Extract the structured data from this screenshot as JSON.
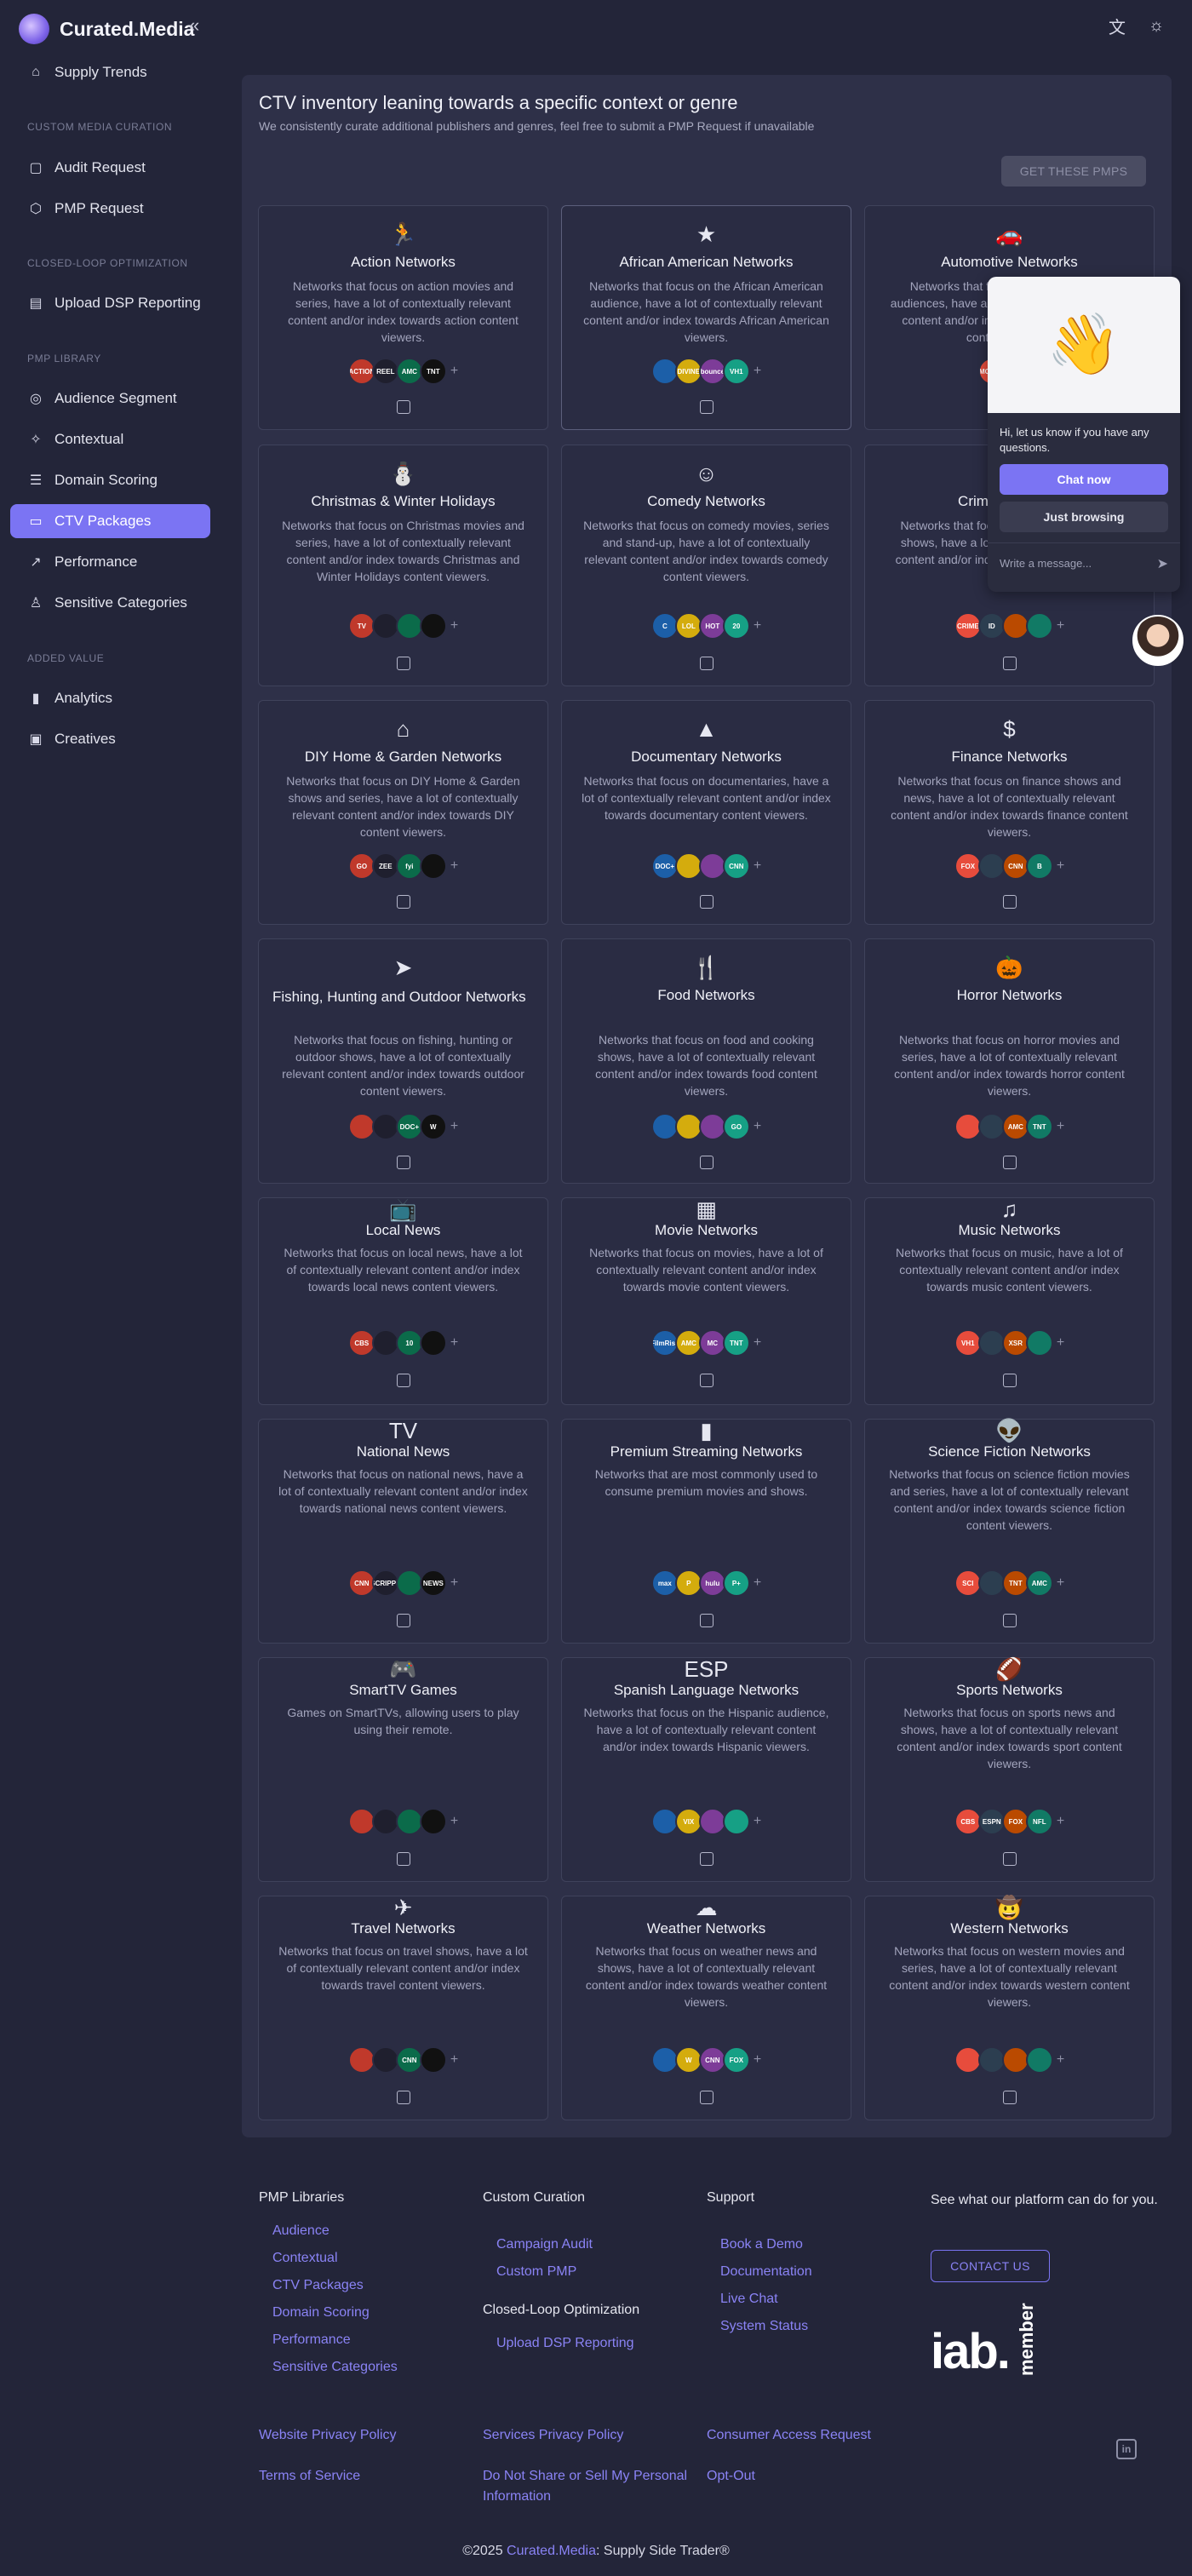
{
  "brand": {
    "name": "Curated.Media"
  },
  "sidebar": {
    "top_items": [
      {
        "label": "Supply Trends",
        "icon": "trend-icon"
      }
    ],
    "sections": [
      {
        "title": "CUSTOM MEDIA CURATION",
        "items": [
          {
            "label": "Audit Request"
          },
          {
            "label": "PMP Request"
          }
        ]
      },
      {
        "title": "CLOSED-LOOP OPTIMIZATION",
        "items": [
          {
            "label": "Upload DSP Reporting"
          }
        ]
      },
      {
        "title": "PMP LIBRARY",
        "items": [
          {
            "label": "Audience Segment"
          },
          {
            "label": "Contextual"
          },
          {
            "label": "Domain Scoring"
          },
          {
            "label": "CTV Packages",
            "active": true
          },
          {
            "label": "Performance"
          },
          {
            "label": "Sensitive Categories"
          }
        ]
      },
      {
        "title": "ADDED VALUE",
        "items": [
          {
            "label": "Analytics"
          },
          {
            "label": "Creatives"
          }
        ]
      }
    ]
  },
  "header": {
    "translate_icon": "translate-icon",
    "theme_icon": "sun-icon"
  },
  "panel": {
    "title": "CTV inventory leaning towards a specific context or genre",
    "subtitle": "We consistently curate additional publishers and genres, feel free to submit a PMP Request if unavailable",
    "cta": "GET THESE PMPS"
  },
  "cards": [
    {
      "icon": "🏃",
      "title": "Action Networks",
      "desc": "Networks that focus on action movies and series, have a lot of contextually relevant content and/or index towards action content viewers.",
      "logos": [
        "ACTION",
        "REEL",
        "AMC",
        "TNT"
      ]
    },
    {
      "icon": "★",
      "title": "African American Networks",
      "desc": "Networks that focus on the African American audience, have a lot of contextually relevant content and/or index towards African American viewers.",
      "logos": [
        "",
        "DIVINE",
        "bounce",
        "VH1"
      ]
    },
    {
      "icon": "🚗",
      "title": "Automotive Networks",
      "desc": "Networks that focus on car enthusiast audiences, have a lot of contextually relevant content and/or index towards automotive content viewers.",
      "logos": [
        "MOTOR",
        "TREND"
      ]
    },
    {
      "icon": "⛄",
      "title": "Christmas & Winter Holidays",
      "desc": "Networks that focus on Christmas movies and series, have a lot of contextually relevant content and/or index towards Christmas and Winter Holidays content viewers.",
      "logos": [
        "TV",
        "",
        "",
        ""
      ]
    },
    {
      "icon": "☺",
      "title": "Comedy Networks",
      "desc": "Networks that focus on comedy movies, series and stand-up, have a lot of contextually relevant content and/or index towards comedy content viewers.",
      "logos": [
        "C",
        "LOL",
        "HOT",
        "20"
      ]
    },
    {
      "icon": "🔍",
      "title": "Crime Networks",
      "desc": "Networks that focus on crime movies and shows, have a lot of contextually relevant content and/or index towards crime content viewers.",
      "logos": [
        "CRIME",
        "ID",
        "",
        ""
      ]
    },
    {
      "icon": "⌂",
      "title": "DIY Home & Garden Networks",
      "desc": "Networks that focus on DIY Home & Garden shows and series, have a lot of contextually relevant content and/or index towards DIY content viewers.",
      "logos": [
        "GO",
        "ZEE",
        "fyi",
        ""
      ]
    },
    {
      "icon": "▲",
      "title": "Documentary Networks",
      "desc": "Networks that focus on documentaries, have a lot of contextually relevant content and/or index towards documentary content viewers.",
      "logos": [
        "DOC+",
        "",
        "",
        "CNN"
      ]
    },
    {
      "icon": "$",
      "title": "Finance Networks",
      "desc": "Networks that focus on finance shows and news, have a lot of contextually relevant content and/or index towards finance content viewers.",
      "logos": [
        "FOX",
        "",
        "CNN",
        "B"
      ]
    },
    {
      "icon": "➤",
      "title": "Fishing, Hunting and Outdoor Networks",
      "desc": "Networks that focus on fishing, hunting or outdoor shows, have a lot of contextually relevant content and/or index towards outdoor content viewers.",
      "logos": [
        "",
        "",
        "DOC+",
        "W"
      ]
    },
    {
      "icon": "🍴",
      "title": "Food Networks",
      "desc": "Networks that focus on food and cooking shows, have a lot of contextually relevant content and/or index towards food content viewers.",
      "logos": [
        "",
        "",
        "",
        "GO"
      ]
    },
    {
      "icon": "🎃",
      "title": "Horror Networks",
      "desc": "Networks that focus on horror movies and series, have a lot of contextually relevant content and/or index towards horror content viewers.",
      "logos": [
        "",
        "",
        "AMC",
        "TNT"
      ]
    },
    {
      "icon": "📺",
      "title": "Local News",
      "desc": "Networks that focus on local news, have a lot of contextually relevant content and/or index towards local news content viewers.",
      "logos": [
        "CBS",
        "",
        "10",
        ""
      ]
    },
    {
      "icon": "▦",
      "title": "Movie Networks",
      "desc": "Networks that focus on movies, have a lot of contextually relevant content and/or index towards movie content viewers.",
      "logos": [
        "FilmRise",
        "AMC",
        "MC",
        "TNT"
      ]
    },
    {
      "icon": "♫",
      "title": "Music Networks",
      "desc": "Networks that focus on music, have a lot of contextually relevant content and/or index towards music content viewers.",
      "logos": [
        "VH1",
        "",
        "XSR",
        ""
      ]
    },
    {
      "icon": "TV",
      "title": "National News",
      "desc": "Networks that focus on national news, have a lot of contextually relevant content and/or index towards national news content viewers.",
      "logos": [
        "CNN",
        "SCRIPPS",
        "",
        "NEWS"
      ]
    },
    {
      "icon": "▮",
      "title": "Premium Streaming Networks",
      "desc": "Networks that are most commonly used to consume premium movies and shows.",
      "logos": [
        "max",
        "P",
        "hulu",
        "P+"
      ]
    },
    {
      "icon": "👽",
      "title": "Science Fiction Networks",
      "desc": "Networks that focus on science fiction movies and series, have a lot of contextually relevant content and/or index towards science fiction content viewers.",
      "logos": [
        "SCI",
        "",
        "TNT",
        "AMC"
      ]
    },
    {
      "icon": "🎮",
      "title": "SmartTV Games",
      "desc": "Games on SmartTVs, allowing users to play using their remote.",
      "logos": [
        "",
        "",
        "",
        ""
      ]
    },
    {
      "icon": "ESP",
      "title": "Spanish Language Networks",
      "desc": "Networks that focus on the Hispanic audience, have a lot of contextually relevant content and/or index towards Hispanic viewers.",
      "logos": [
        "",
        "VIX",
        "",
        ""
      ]
    },
    {
      "icon": "🏈",
      "title": "Sports Networks",
      "desc": "Networks that focus on sports news and shows, have a lot of contextually relevant content and/or index towards sport content viewers.",
      "logos": [
        "CBS",
        "ESPN",
        "FOX",
        "NFL"
      ]
    },
    {
      "icon": "✈",
      "title": "Travel Networks",
      "desc": "Networks that focus on travel shows, have a lot of contextually relevant content and/or index towards travel content viewers.",
      "logos": [
        "",
        "",
        "CNN",
        ""
      ]
    },
    {
      "icon": "☁",
      "title": "Weather Networks",
      "desc": "Networks that focus on weather news and shows, have a lot of contextually relevant content and/or index towards weather content viewers.",
      "logos": [
        "",
        "W",
        "CNN",
        "FOX"
      ]
    },
    {
      "icon": "🤠",
      "title": "Western Networks",
      "desc": "Networks that focus on western movies and series, have a lot of contextually relevant content and/or index towards western content viewers.",
      "logos": [
        "",
        "",
        "",
        ""
      ]
    }
  ],
  "chat": {
    "message": "Hi, let us know if you have any questions.",
    "primary": "Chat now",
    "secondary": "Just browsing",
    "placeholder": "Write a message..."
  },
  "footer": {
    "pmp_libraries": {
      "title": "PMP Libraries",
      "links": [
        "Audience",
        "Contextual",
        "CTV Packages",
        "Domain Scoring",
        "Performance",
        "Sensitive Categories"
      ]
    },
    "custom_curation": {
      "title": "Custom Curation",
      "links": [
        "Campaign Audit",
        "Custom PMP"
      ]
    },
    "closed_loop": {
      "title": "Closed-Loop Optimization",
      "links": [
        "Upload DSP Reporting"
      ]
    },
    "support": {
      "title": "Support",
      "links": [
        "Book a Demo",
        "Documentation",
        "Live Chat",
        "System Status"
      ]
    },
    "promo": {
      "text": "See what our platform can do for you.",
      "cta": "CONTACT US"
    },
    "iab": {
      "main": "iab.",
      "sub": "member"
    },
    "legal": {
      "col1": [
        "Website Privacy Policy",
        "Terms of Service"
      ],
      "col2": [
        "Services Privacy Policy",
        "Do Not Share or Sell My Personal Information"
      ],
      "col3": [
        "Consumer Access Request",
        "Opt-Out"
      ]
    },
    "copyright_prefix": "©2025 ",
    "copyright_link": "Curated.Media",
    "copyright_suffix": ": Supply Side Trader®"
  }
}
